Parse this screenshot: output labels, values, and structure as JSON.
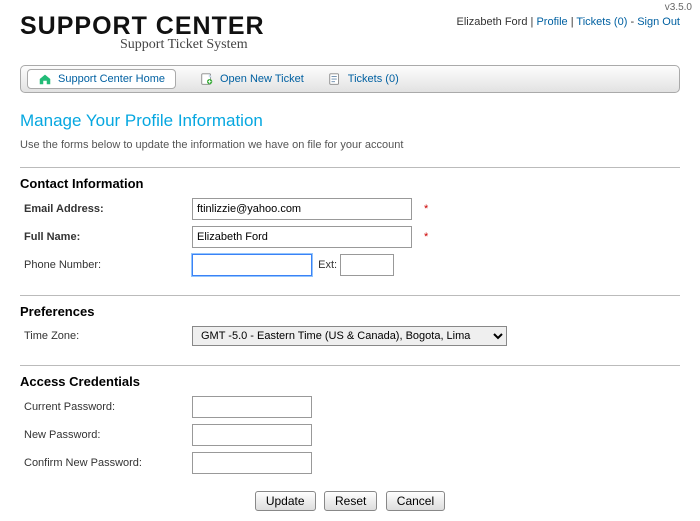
{
  "version": "v3.5.0",
  "logo": {
    "title": "SUPPORT CENTER",
    "subtitle": "Support Ticket System"
  },
  "user": {
    "name": "Elizabeth Ford",
    "ticket_count": 0,
    "links": {
      "profile": "Profile",
      "tickets": "Tickets",
      "signout": "Sign Out"
    }
  },
  "nav": {
    "home": "Support Center Home",
    "open": "Open New Ticket",
    "tickets": "Tickets"
  },
  "page": {
    "title": "Manage Your Profile Information",
    "subtitle": "Use the forms below to update the information we have on file for your account"
  },
  "sections": {
    "contact": {
      "title": "Contact Information",
      "email_label": "Email Address:",
      "email_value": "ftinlizzie@yahoo.com",
      "name_label": "Full Name:",
      "name_value": "Elizabeth Ford",
      "phone_label": "Phone Number:",
      "phone_value": "",
      "ext_label": "Ext:",
      "ext_value": ""
    },
    "prefs": {
      "title": "Preferences",
      "tz_label": "Time Zone:",
      "tz_value": "GMT -5.0 - Eastern Time (US & Canada), Bogota, Lima"
    },
    "creds": {
      "title": "Access Credentials",
      "current_label": "Current Password:",
      "new_label": "New Password:",
      "confirm_label": "Confirm New Password:"
    }
  },
  "buttons": {
    "update": "Update",
    "reset": "Reset",
    "cancel": "Cancel"
  }
}
